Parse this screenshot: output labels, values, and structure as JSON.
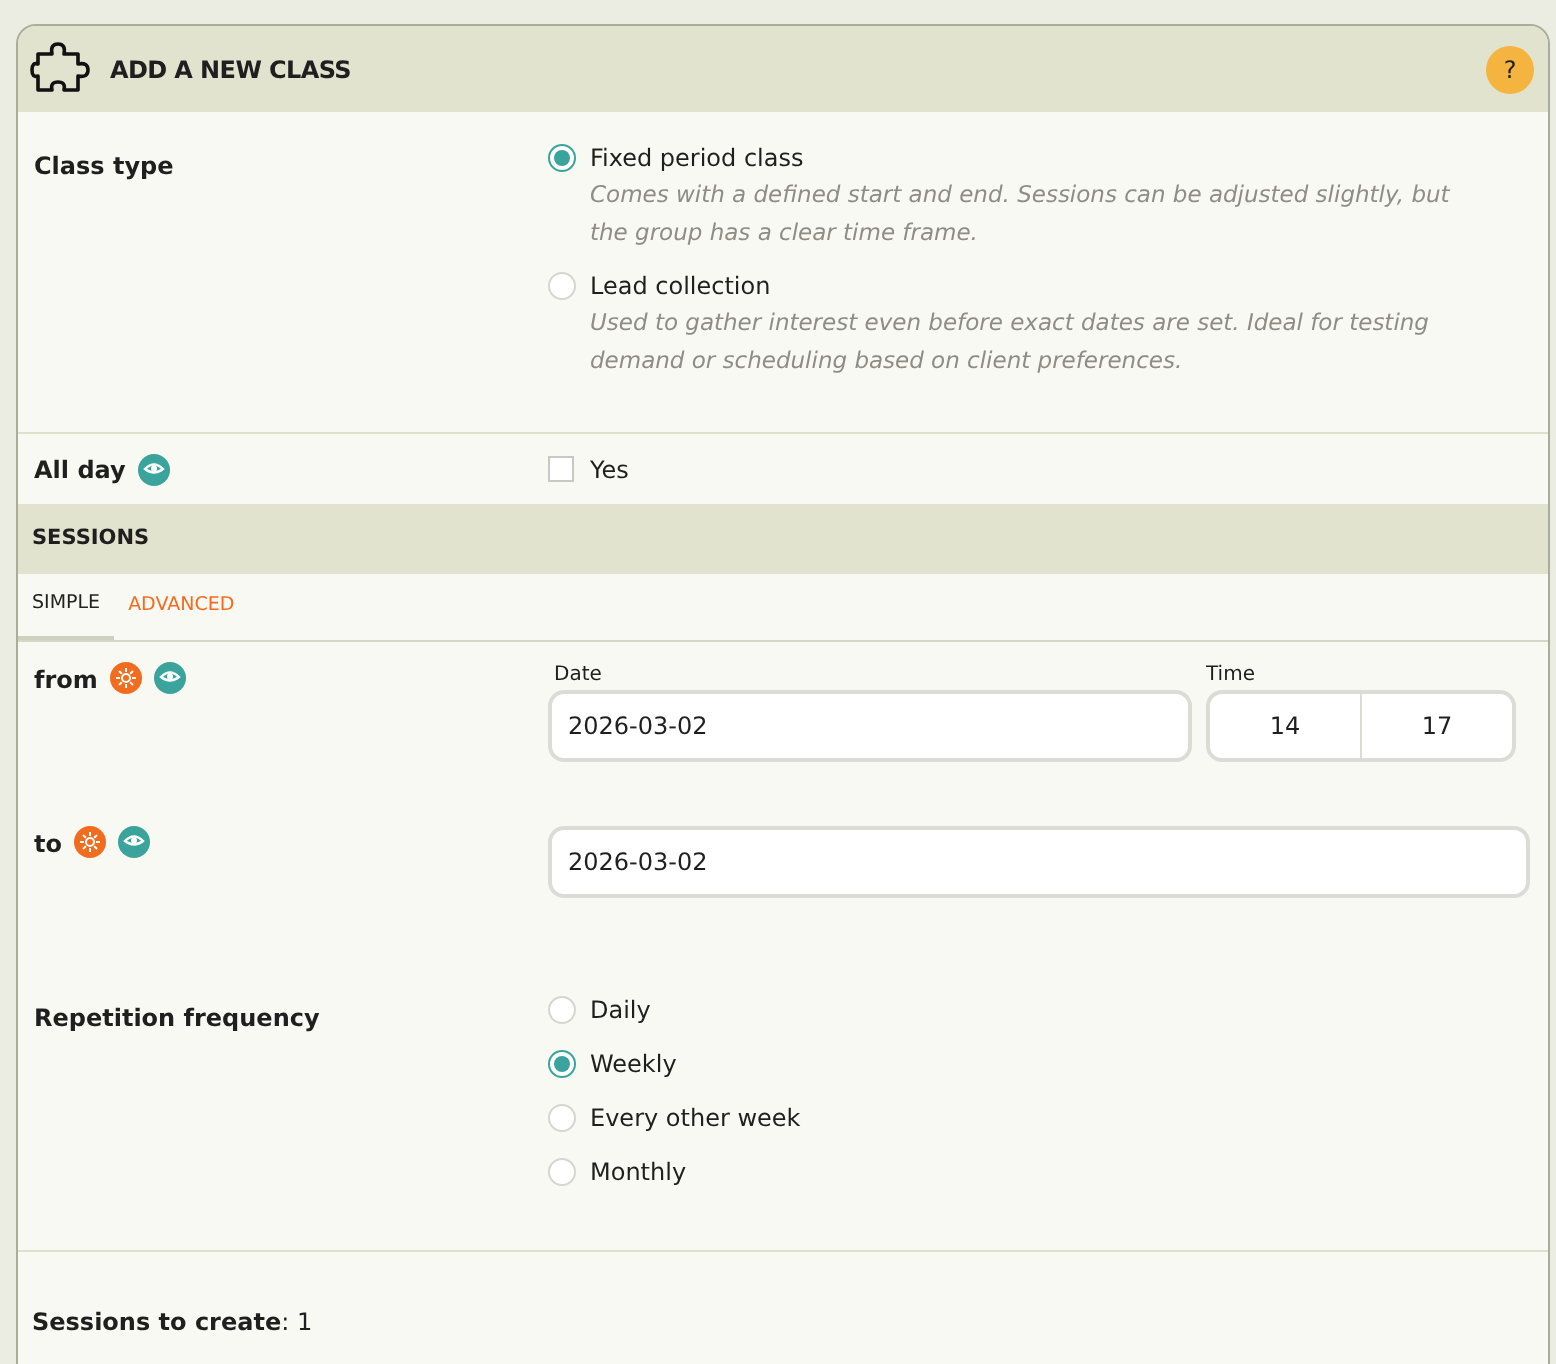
{
  "header": {
    "title": "ADD A NEW CLASS",
    "help": "?"
  },
  "class_type": {
    "label": "Class type",
    "options": [
      {
        "label": "Fixed period class",
        "description": "Comes with a defined start and end. Sessions can be adjusted slightly, but the group has a clear time frame.",
        "selected": true
      },
      {
        "label": "Lead collection",
        "description": "Used to gather interest even before exact dates are set. Ideal for testing demand or scheduling based on client preferences.",
        "selected": false
      }
    ]
  },
  "all_day": {
    "label": "All day",
    "option": "Yes",
    "checked": false
  },
  "sessions": {
    "title": "SESSIONS",
    "tabs": [
      {
        "label": "SIMPLE",
        "selected": true
      },
      {
        "label": "ADVANCED",
        "selected": false
      }
    ],
    "from": {
      "label": "from",
      "date_label": "Date",
      "date": "2026-03-02",
      "time_label": "Time",
      "hour": "14",
      "minute": "17"
    },
    "to": {
      "label": "to",
      "date": "2026-03-02"
    },
    "repetition": {
      "label": "Repetition frequency",
      "options": [
        {
          "label": "Daily",
          "selected": false
        },
        {
          "label": "Weekly",
          "selected": true
        },
        {
          "label": "Every other week",
          "selected": false
        },
        {
          "label": "Monthly",
          "selected": false
        }
      ]
    },
    "count": {
      "text": "**Sessions to create**: 1"
    }
  }
}
